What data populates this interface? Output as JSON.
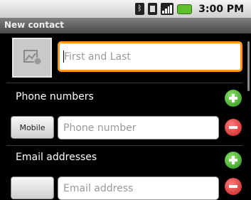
{
  "status_bar": {
    "time": "3:00 PM"
  },
  "title_bar": {
    "title": "New contact"
  },
  "name_field": {
    "placeholder": "First and Last"
  },
  "phone_section": {
    "label": "Phone numbers",
    "type_button": "Mobile",
    "placeholder": "Phone number"
  },
  "email_section": {
    "label": "Email addresses",
    "type_button": "",
    "placeholder": "Email address"
  },
  "colors": {
    "focus_border": "#ff9a1c",
    "add_button": "#2c8f1a",
    "remove_button": "#c11f1f",
    "battery": "#5ec02d"
  }
}
